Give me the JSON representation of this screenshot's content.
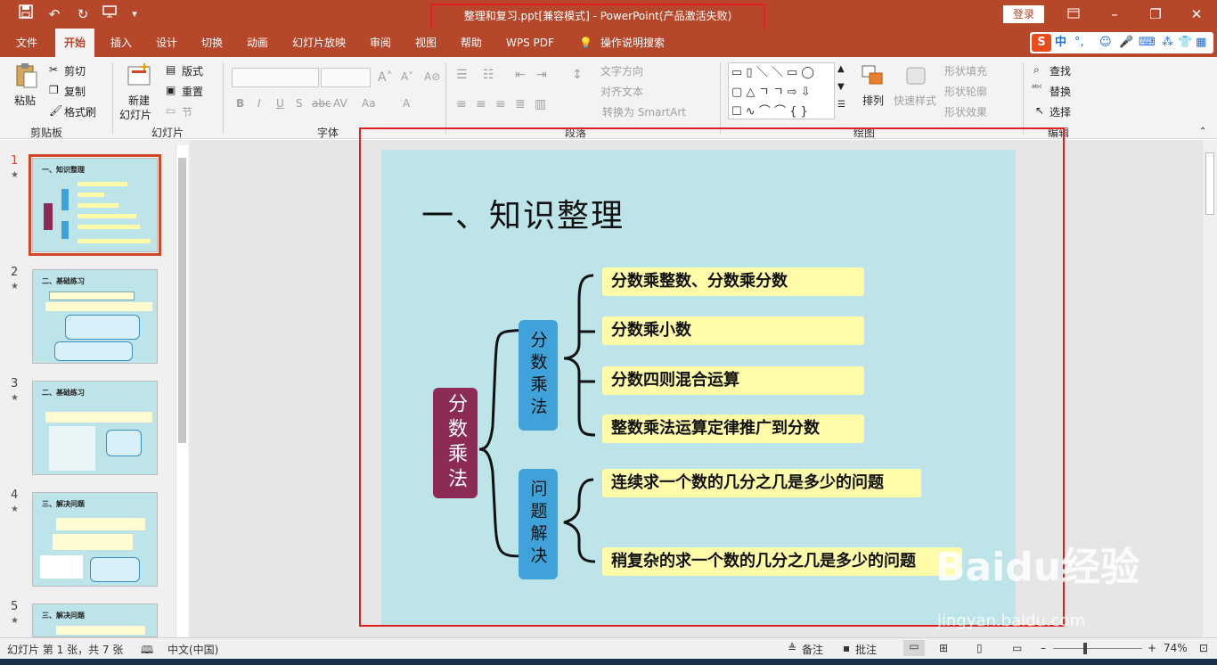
{
  "titlebar": {
    "title": "整理和复习.ppt[兼容模式]  -  PowerPoint(产品激活失败)",
    "login": "登录",
    "icons": [
      "save-icon",
      "undo-icon",
      "redo-icon",
      "start-slideshow-icon",
      "customize-icon",
      "ribbon-display-icon",
      "minimize-icon",
      "restore-icon",
      "close-icon"
    ]
  },
  "tabs": [
    "文件",
    "开始",
    "插入",
    "设计",
    "切换",
    "动画",
    "幻灯片放映",
    "审阅",
    "视图",
    "帮助",
    "WPS PDF",
    "操作说明搜索"
  ],
  "ime": {
    "brand": "S",
    "label": "中"
  },
  "ribbon": {
    "clipboard": {
      "paste": "粘贴",
      "cut": "剪切",
      "copy": "复制",
      "format_painter": "格式刷",
      "group": "剪贴板"
    },
    "slides": {
      "new_slide": "新建",
      "new_slide2": "幻灯片",
      "layout": "版式",
      "reset": "重置",
      "section": "节",
      "group": "幻灯片"
    },
    "font": {
      "group": "字体",
      "buttons": [
        "B",
        "I",
        "U",
        "S",
        "abc",
        "AV",
        "Aa",
        "A"
      ]
    },
    "paragraph": {
      "group": "段落",
      "text_direction": "文字方向",
      "align_text": "对齐文本",
      "smartart": "转换为 SmartArt"
    },
    "drawing": {
      "group": "绘图",
      "arrange": "排列",
      "quick_styles": "快速样式",
      "shape_fill": "形状填充",
      "shape_outline": "形状轮廓",
      "shape_effects": "形状效果"
    },
    "editing": {
      "group": "编辑",
      "find": "查找",
      "replace": "替换",
      "select": "选择"
    }
  },
  "thumbnails": [
    {
      "num": "1",
      "title": "一、知识整理"
    },
    {
      "num": "2",
      "title": "二、基础练习"
    },
    {
      "num": "3",
      "title": "二、基础练习"
    },
    {
      "num": "4",
      "title": "三、解决问题"
    },
    {
      "num": "5",
      "title": "三、解决问题"
    }
  ],
  "slide": {
    "title": "一、知识整理",
    "root": "分数乘法",
    "branch1": "分数乘法",
    "branch2": "问题解决",
    "items1": [
      "分数乘整数、分数乘分数",
      "分数乘小数",
      "分数四则混合运算",
      "整数乘法运算定律推广到分数"
    ],
    "items2": [
      "连续求一个数的几分之几是多少的问题",
      "稍复杂的求一个数的几分之几是多少的问题"
    ],
    "colors": {
      "slide_bg": "#bde4e8",
      "root_box": "#8b2b56",
      "branch_box": "#3fa3d9",
      "item_bg": "#fffba8",
      "accent": "#b7472a"
    }
  },
  "statusbar": {
    "slide_info": "幻灯片 第 1 张，共 7 张",
    "language": "中文(中国)",
    "notes": "备注",
    "comments": "批注",
    "zoom": "74%"
  },
  "watermark": {
    "brand": "Baidu经验",
    "url": "jingyan.baidu.com"
  }
}
